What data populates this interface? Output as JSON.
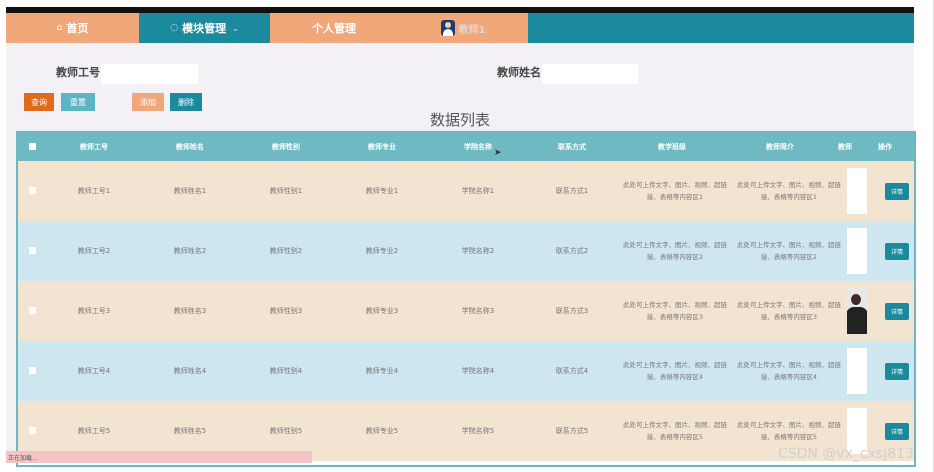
{
  "nav": {
    "home": "首页",
    "module_management": "模块管理",
    "personal_management": "个人管理",
    "user_name": "教师1"
  },
  "search": {
    "field1_label": "教师工号",
    "field1_value": "",
    "field2_label": "教师姓名",
    "field2_value": ""
  },
  "toolbar": {
    "query": "查询",
    "reset": "重置",
    "add": "添加",
    "delete": "删除"
  },
  "list_title": "数据列表",
  "table": {
    "headers": [
      "教师工号",
      "教师姓名",
      "教师性别",
      "教师专业",
      "学院名称",
      "联系方式",
      "教学班级",
      "教师简介",
      "教师",
      "操作"
    ],
    "detail_label": "详情",
    "rows": [
      [
        "教师工号1",
        "教师姓名1",
        "教师性别1",
        "教师专业1",
        "学院名称1",
        "联系方式1",
        "此处可上传文字、图片、视频、超链接、表格等内容区1",
        "此处可上传文字、图片、视频、超链接、表格等内容区1"
      ],
      [
        "教师工号2",
        "教师姓名2",
        "教师性别2",
        "教师专业2",
        "学院名称2",
        "联系方式2",
        "此处可上传文字、图片、视频、超链接、表格等内容区2",
        "此处可上传文字、图片、视频、超链接、表格等内容区2"
      ],
      [
        "教师工号3",
        "教师姓名3",
        "教师性别3",
        "教师专业3",
        "学院名称3",
        "联系方式3",
        "此处可上传文字、图片、视频、超链接、表格等内容区3",
        "此处可上传文字、图片、视频、超链接、表格等内容区3"
      ],
      [
        "教师工号4",
        "教师姓名4",
        "教师性别4",
        "教师专业4",
        "学院名称4",
        "联系方式4",
        "此处可上传文字、图片、视频、超链接、表格等内容区4",
        "此处可上传文字、图片、视频、超链接、表格等内容区4"
      ],
      [
        "教师工号5",
        "教师姓名5",
        "教师性别5",
        "教师专业5",
        "学院名称5",
        "联系方式5",
        "此处可上传文字、图片、视频、超链接、表格等内容区5",
        "此处可上传文字、图片、视频、超链接、表格等内容区5"
      ]
    ]
  },
  "status_bar": "正在加载...",
  "watermark": "CSDN @vx_cxsj813",
  "colors": {
    "accent_teal": "#1a8a9c",
    "nav_orange": "#f0a77a",
    "query_button": "#e06a1b",
    "reset_button": "#5fb4c4",
    "add_button": "#f0a77a",
    "row_odd": "#f3e4d2",
    "row_even": "#cde6f0"
  },
  "icons": [
    "home-icon",
    "module-icon",
    "chevron-down-icon",
    "user-avatar",
    "select-all-checkbox",
    "row-checkbox",
    "mouse-cursor-icon"
  ]
}
